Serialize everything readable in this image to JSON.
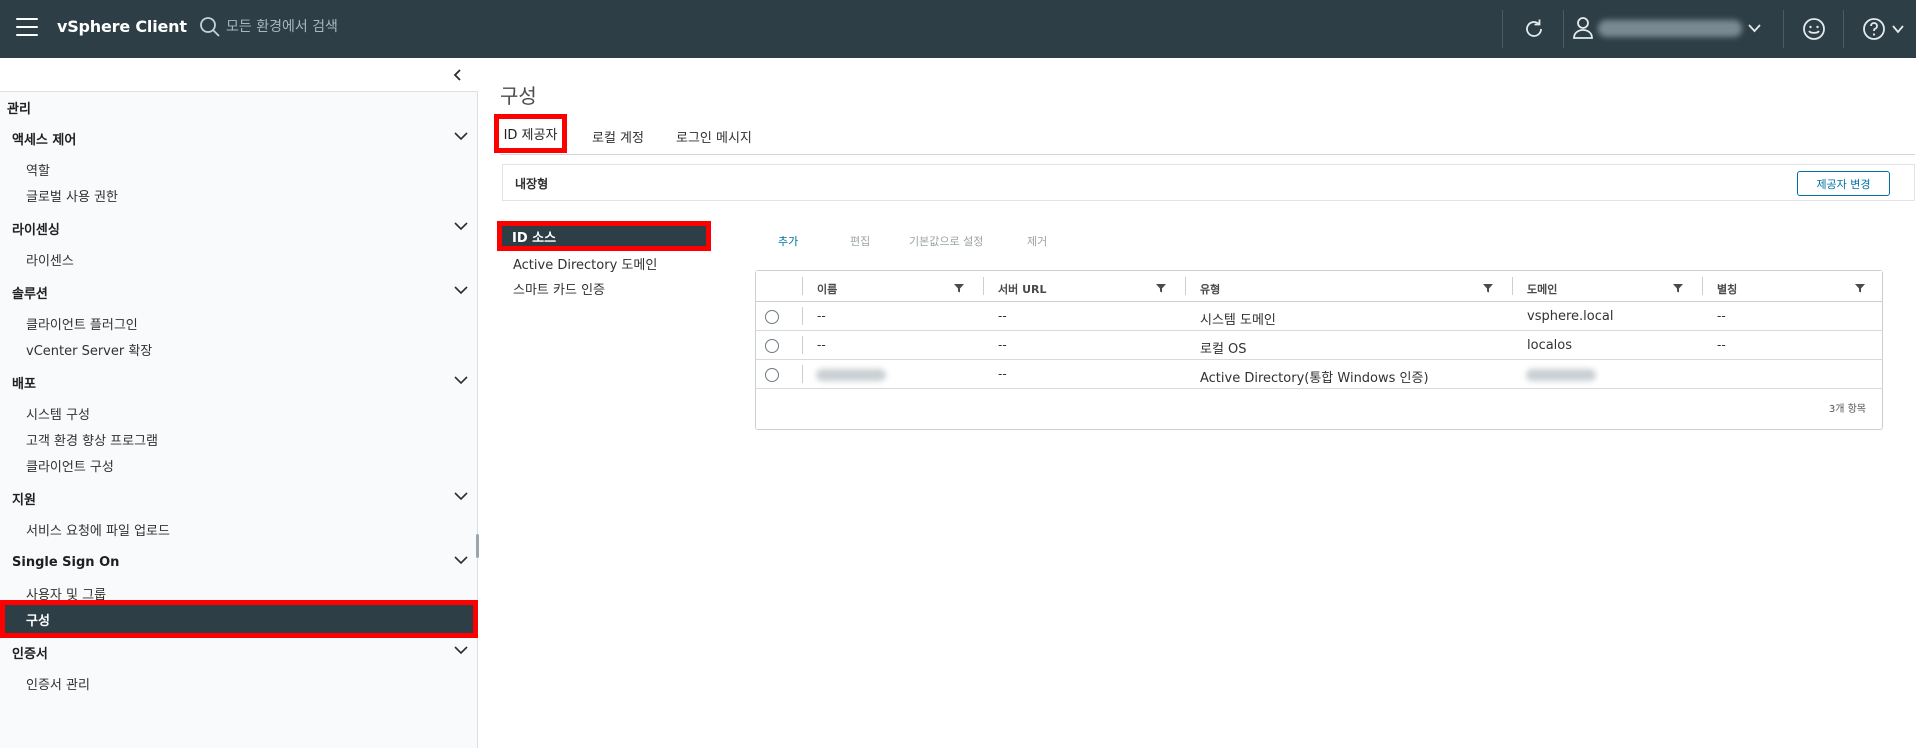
{
  "header": {
    "app_title": "vSphere Client",
    "search_placeholder": "모든 환경에서 검색",
    "icons": [
      "hamburger-menu-icon",
      "search-icon",
      "refresh-icon",
      "user-icon",
      "chevron-down-icon",
      "smiley-feedback-icon",
      "help-icon"
    ]
  },
  "sidebar": {
    "root": "관리",
    "groups": [
      {
        "label": "액세스 제어",
        "items": [
          "역할",
          "글로벌 사용 권한"
        ]
      },
      {
        "label": "라이센싱",
        "items": [
          "라이센스"
        ]
      },
      {
        "label": "솔루션",
        "items": [
          "클라이언트 플러그인",
          "vCenter Server 확장"
        ]
      },
      {
        "label": "배포",
        "items": [
          "시스템 구성",
          "고객 환경 향상 프로그램",
          "클라이언트 구성"
        ]
      },
      {
        "label": "지원",
        "items": [
          "서비스 요청에 파일 업로드"
        ]
      },
      {
        "label": "Single Sign On",
        "items": [
          "사용자 및 그룹",
          "구성"
        ]
      },
      {
        "label": "인증서",
        "items": [
          "인증서 관리"
        ]
      }
    ],
    "selected_item": "구성"
  },
  "main": {
    "title": "구성",
    "tabs": [
      {
        "label": "ID 제공자",
        "active": true
      },
      {
        "label": "로컬 계정",
        "active": false
      },
      {
        "label": "로그인 메시지",
        "active": false
      }
    ],
    "provider": {
      "label": "내장형",
      "change_button": "제공자 변경"
    },
    "id_menu": [
      {
        "label": "ID 소스",
        "selected": true
      },
      {
        "label": "Active Directory 도메인",
        "selected": false
      },
      {
        "label": "스마트 카드 인증",
        "selected": false
      }
    ],
    "toolbar": {
      "add": "추가",
      "edit": "편집",
      "set_default": "기본값으로 설정",
      "remove": "제거"
    },
    "grid": {
      "columns": [
        "이름",
        "서버 URL",
        "유형",
        "도메인",
        "별칭"
      ],
      "rows": [
        {
          "name": "--",
          "server_url": "--",
          "type": "시스템 도메인",
          "domain": "vsphere.local",
          "alias": "--"
        },
        {
          "name": "--",
          "server_url": "--",
          "type": "로컬 OS",
          "domain": "localos",
          "alias": "--"
        },
        {
          "name": "",
          "server_url": "--",
          "type": "Active Directory(통합 Windows 인증)",
          "domain": "",
          "alias": ""
        }
      ],
      "footer": "3개 항목"
    }
  },
  "colors": {
    "header_bg": "#2d3e46",
    "highlight": "#ff0000",
    "link": "#0072a3",
    "sidebar_bg": "#f9fafb"
  }
}
